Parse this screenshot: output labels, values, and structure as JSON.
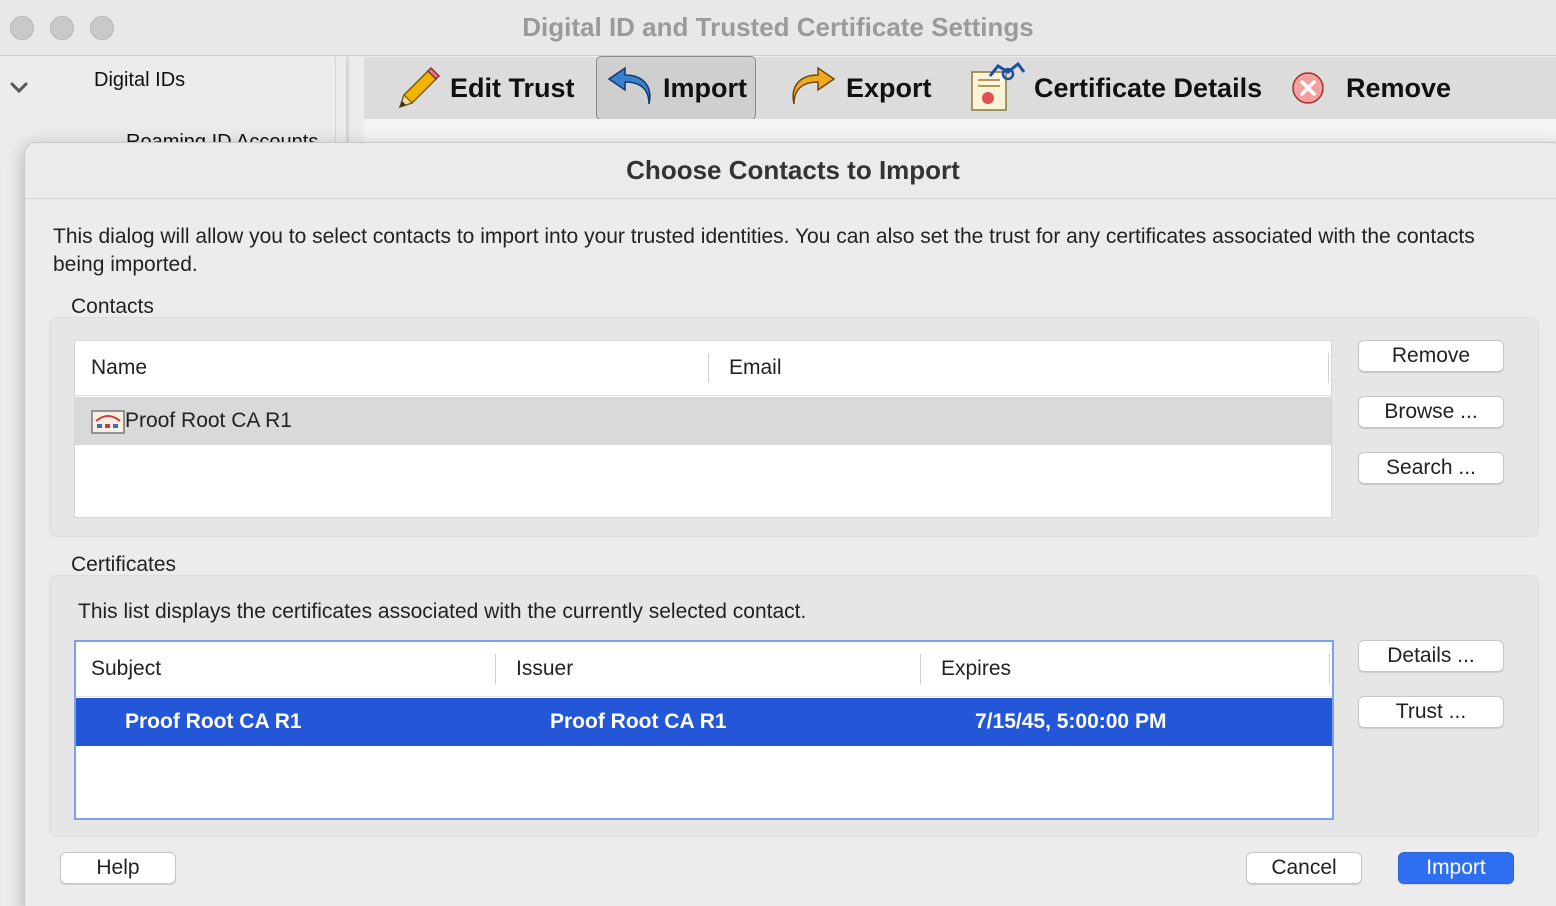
{
  "window": {
    "title": "Digital ID and Trusted Certificate Settings"
  },
  "sidebar": {
    "items": [
      {
        "label": "Digital IDs"
      },
      {
        "label": "Roaming ID Accounts"
      }
    ]
  },
  "toolbar": {
    "edit_trust": "Edit Trust",
    "import": "Import",
    "export": "Export",
    "certificate_details": "Certificate Details",
    "remove": "Remove"
  },
  "dialog": {
    "title": "Choose Contacts to Import",
    "description": "This dialog will allow you to select contacts to import into your trusted identities. You can also set the trust for any certificates associated with the contacts being imported.",
    "contacts": {
      "label": "Contacts",
      "columns": [
        "Name",
        "Email"
      ],
      "rows": [
        {
          "name": "Proof Root CA R1",
          "email": ""
        }
      ],
      "buttons": {
        "remove": "Remove",
        "browse": "Browse ...",
        "search": "Search ..."
      }
    },
    "certificates": {
      "label": "Certificates",
      "description": "This list displays the certificates associated with the currently selected contact.",
      "columns": [
        "Subject",
        "Issuer",
        "Expires"
      ],
      "rows": [
        {
          "subject": "Proof Root CA R1",
          "issuer": "Proof Root CA R1",
          "expires": "7/15/45, 5:00:00 PM"
        }
      ],
      "buttons": {
        "details": "Details ...",
        "trust": "Trust ..."
      }
    },
    "footer": {
      "help": "Help",
      "cancel": "Cancel",
      "import": "Import"
    }
  },
  "colors": {
    "selection": "#2457d8",
    "primary_button": "#2e6ff2",
    "contact_selection": "#d9d9d9"
  }
}
